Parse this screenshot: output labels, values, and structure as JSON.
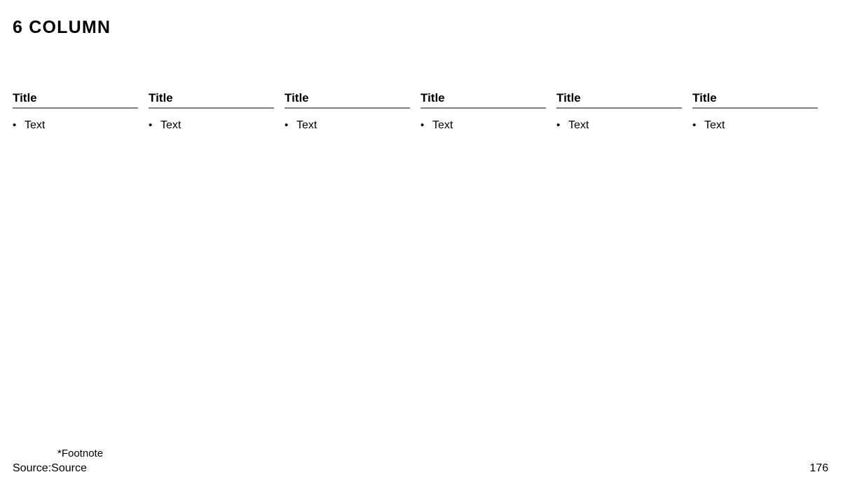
{
  "slide": {
    "title": "6 COLUMN",
    "page_number": "176",
    "accent_rule_color": "#808080",
    "text_color": "#000000",
    "background_color": "#ffffff"
  },
  "columns": [
    {
      "title": "Title",
      "bullets": [
        {
          "marker": "•",
          "text": "Text"
        }
      ]
    },
    {
      "title": "Title",
      "bullets": [
        {
          "marker": "•",
          "text": "Text"
        }
      ]
    },
    {
      "title": "Title",
      "bullets": [
        {
          "marker": "•",
          "text": "Text"
        }
      ]
    },
    {
      "title": "Title",
      "bullets": [
        {
          "marker": "•",
          "text": "Text"
        }
      ]
    },
    {
      "title": "Title",
      "bullets": [
        {
          "marker": "•",
          "text": "Text"
        }
      ]
    },
    {
      "title": "Title",
      "bullets": [
        {
          "marker": "•",
          "text": "Text"
        }
      ]
    }
  ],
  "footer": {
    "footnote": "*Footnote",
    "source": "Source:Source"
  }
}
